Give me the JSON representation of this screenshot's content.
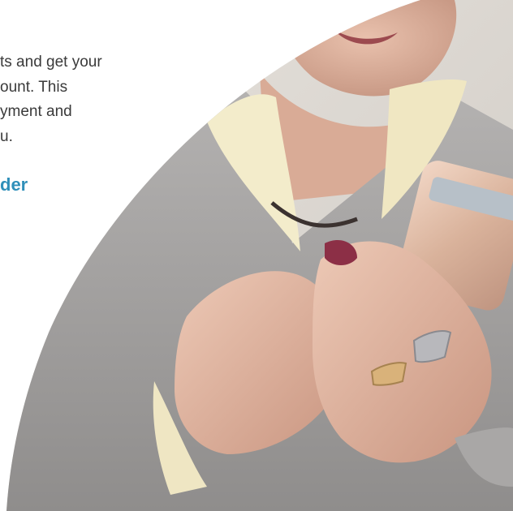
{
  "intro": {
    "line1": "ts and get your",
    "line2": "ount. This",
    "line3": "yment and",
    "line4": "u."
  },
  "cta": {
    "label": "der"
  },
  "colors": {
    "body_text": "#3a3a3a",
    "link": "#2f8fb9",
    "background": "#ffffff"
  },
  "hero": {
    "image": "hero-photo-elderly-woman-holding-smartphone"
  }
}
